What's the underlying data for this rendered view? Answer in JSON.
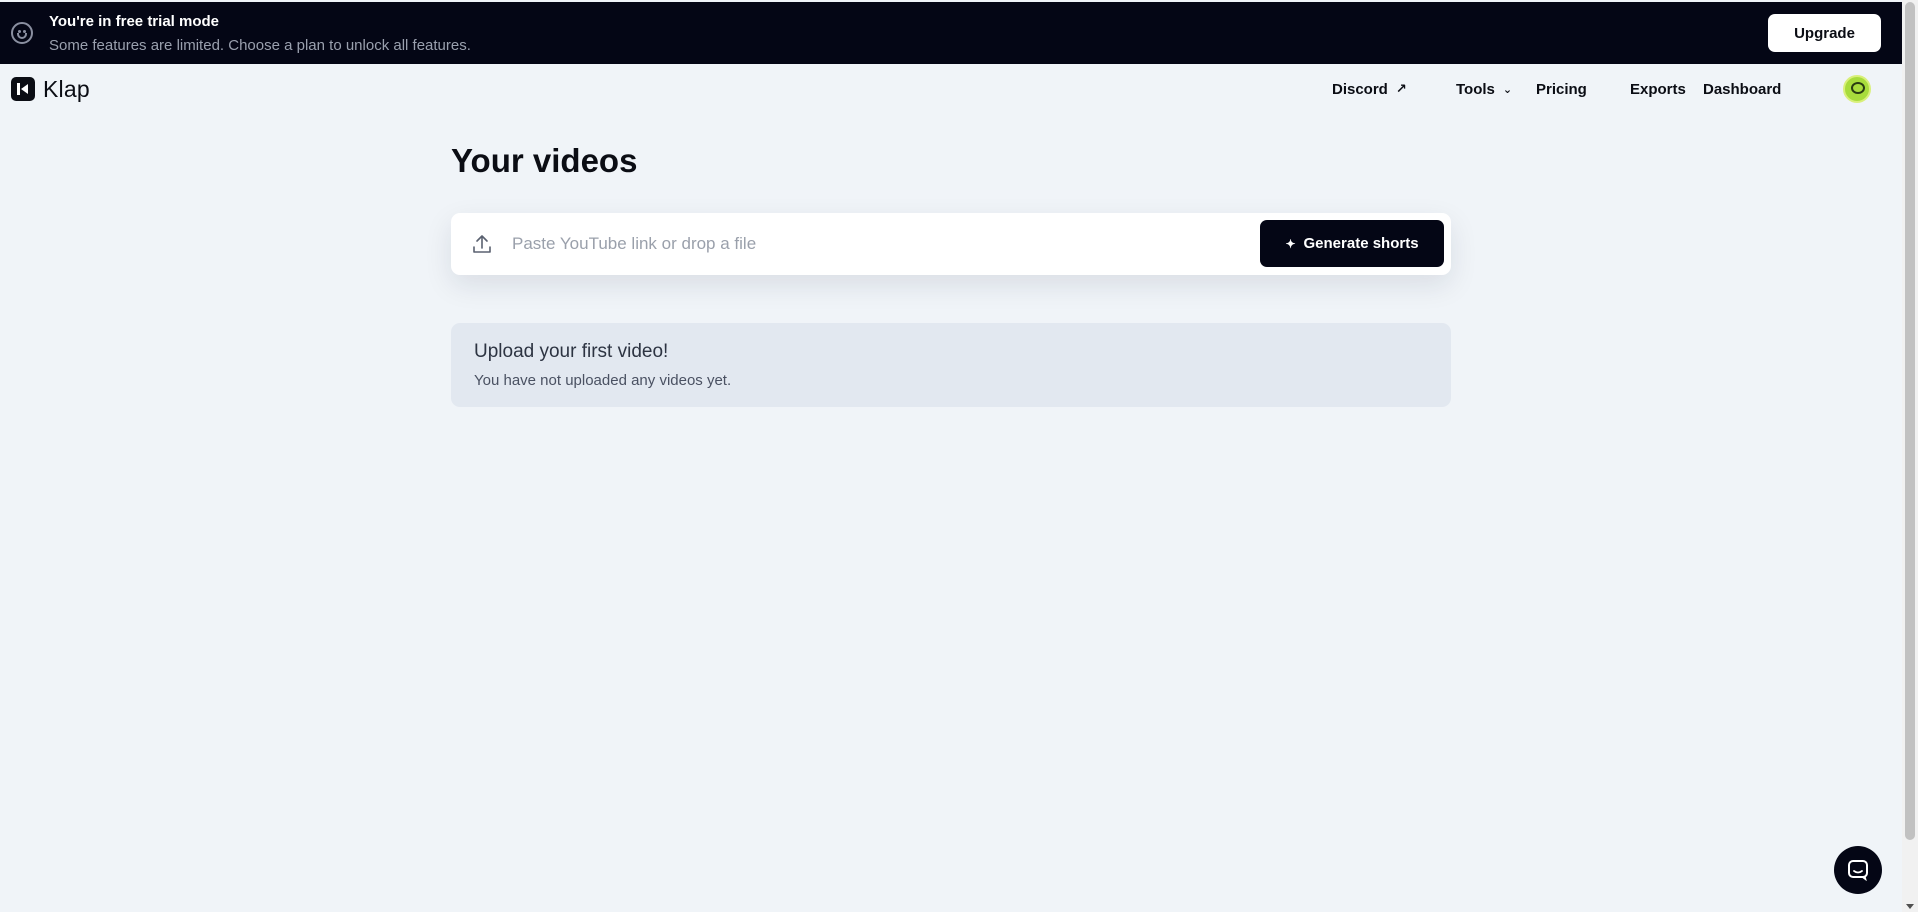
{
  "banner": {
    "title": "You're in free trial mode",
    "subtitle": "Some features are limited. Choose a plan to unlock all features.",
    "upgrade_label": "Upgrade",
    "icon": "smiley-icon"
  },
  "nav": {
    "logo_text": "Klap",
    "links": [
      {
        "label": "Discord",
        "icon": "external-arrow-icon"
      },
      {
        "label": "Tools",
        "icon": "chevron-down-icon"
      },
      {
        "label": "Pricing"
      },
      {
        "label": "Exports"
      },
      {
        "label": "Dashboard"
      }
    ],
    "avatar_icon": "avatar-icon"
  },
  "main": {
    "title": "Your videos",
    "input_placeholder": "Paste YouTube link or drop a file",
    "input_value": "",
    "generate_label": "Generate shorts",
    "empty_title": "Upload your first video!",
    "empty_subtitle": "You have not uploaded any videos yet."
  },
  "chat": {
    "icon": "chat-icon"
  },
  "colors": {
    "background": "#f0f4f8",
    "banner_bg": "#040615",
    "primary_button": "#040615",
    "empty_card_bg": "#e2e8f0",
    "avatar_accent": "#a8dc3c"
  }
}
